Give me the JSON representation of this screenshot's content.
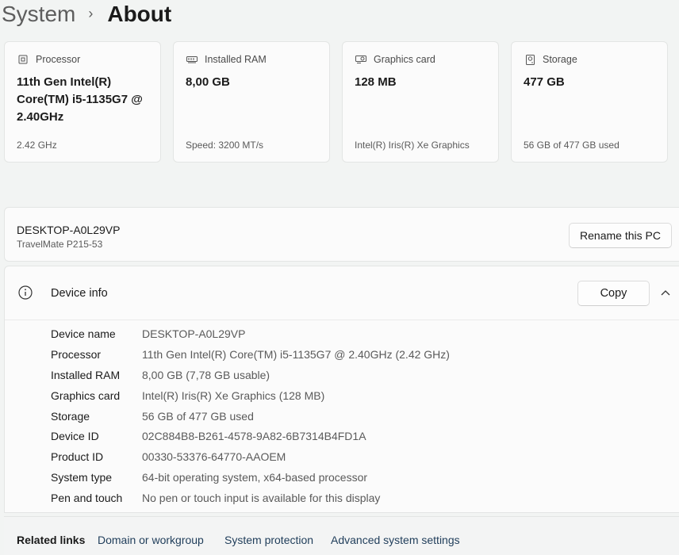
{
  "breadcrumb": {
    "parent": "System",
    "separator": "›",
    "current": "About"
  },
  "cards": [
    {
      "icon": "processor-icon",
      "label": "Processor",
      "value": "11th Gen Intel(R) Core(TM) i5-1135G7 @ 2.40GHz",
      "sub": "2.42 GHz"
    },
    {
      "icon": "ram-icon",
      "label": "Installed RAM",
      "value": "8,00 GB",
      "sub": "Speed: 3200 MT/s"
    },
    {
      "icon": "graphics-card-icon",
      "label": "Graphics card",
      "value": "128 MB",
      "sub": "Intel(R) Iris(R) Xe Graphics"
    },
    {
      "icon": "storage-icon",
      "label": "Storage",
      "value": "477 GB",
      "sub": "56 GB of 477 GB used"
    }
  ],
  "pc": {
    "name": "DESKTOP-A0L29VP",
    "model": "TravelMate P215-53",
    "rename_label": "Rename this PC"
  },
  "device_info": {
    "title": "Device info",
    "copy_label": "Copy",
    "rows": [
      {
        "key": "Device name",
        "value": "DESKTOP-A0L29VP"
      },
      {
        "key": "Processor",
        "value": "11th Gen Intel(R) Core(TM) i5-1135G7 @ 2.40GHz (2.42 GHz)"
      },
      {
        "key": "Installed RAM",
        "value": "8,00 GB (7,78 GB usable)"
      },
      {
        "key": "Graphics card",
        "value": "Intel(R) Iris(R) Xe Graphics (128 MB)"
      },
      {
        "key": "Storage",
        "value": "56 GB of 477 GB used"
      },
      {
        "key": "Device ID",
        "value": "02C884B8-B261-4578-9A82-6B7314B4FD1A"
      },
      {
        "key": "Product ID",
        "value": "00330-53376-64770-AAOEM"
      },
      {
        "key": "System type",
        "value": "64-bit operating system, x64-based processor"
      },
      {
        "key": "Pen and touch",
        "value": "No pen or touch input is available for this display"
      }
    ]
  },
  "related_links": {
    "label": "Related links",
    "links": [
      "Domain or workgroup",
      "System protection",
      "Advanced system settings"
    ]
  }
}
